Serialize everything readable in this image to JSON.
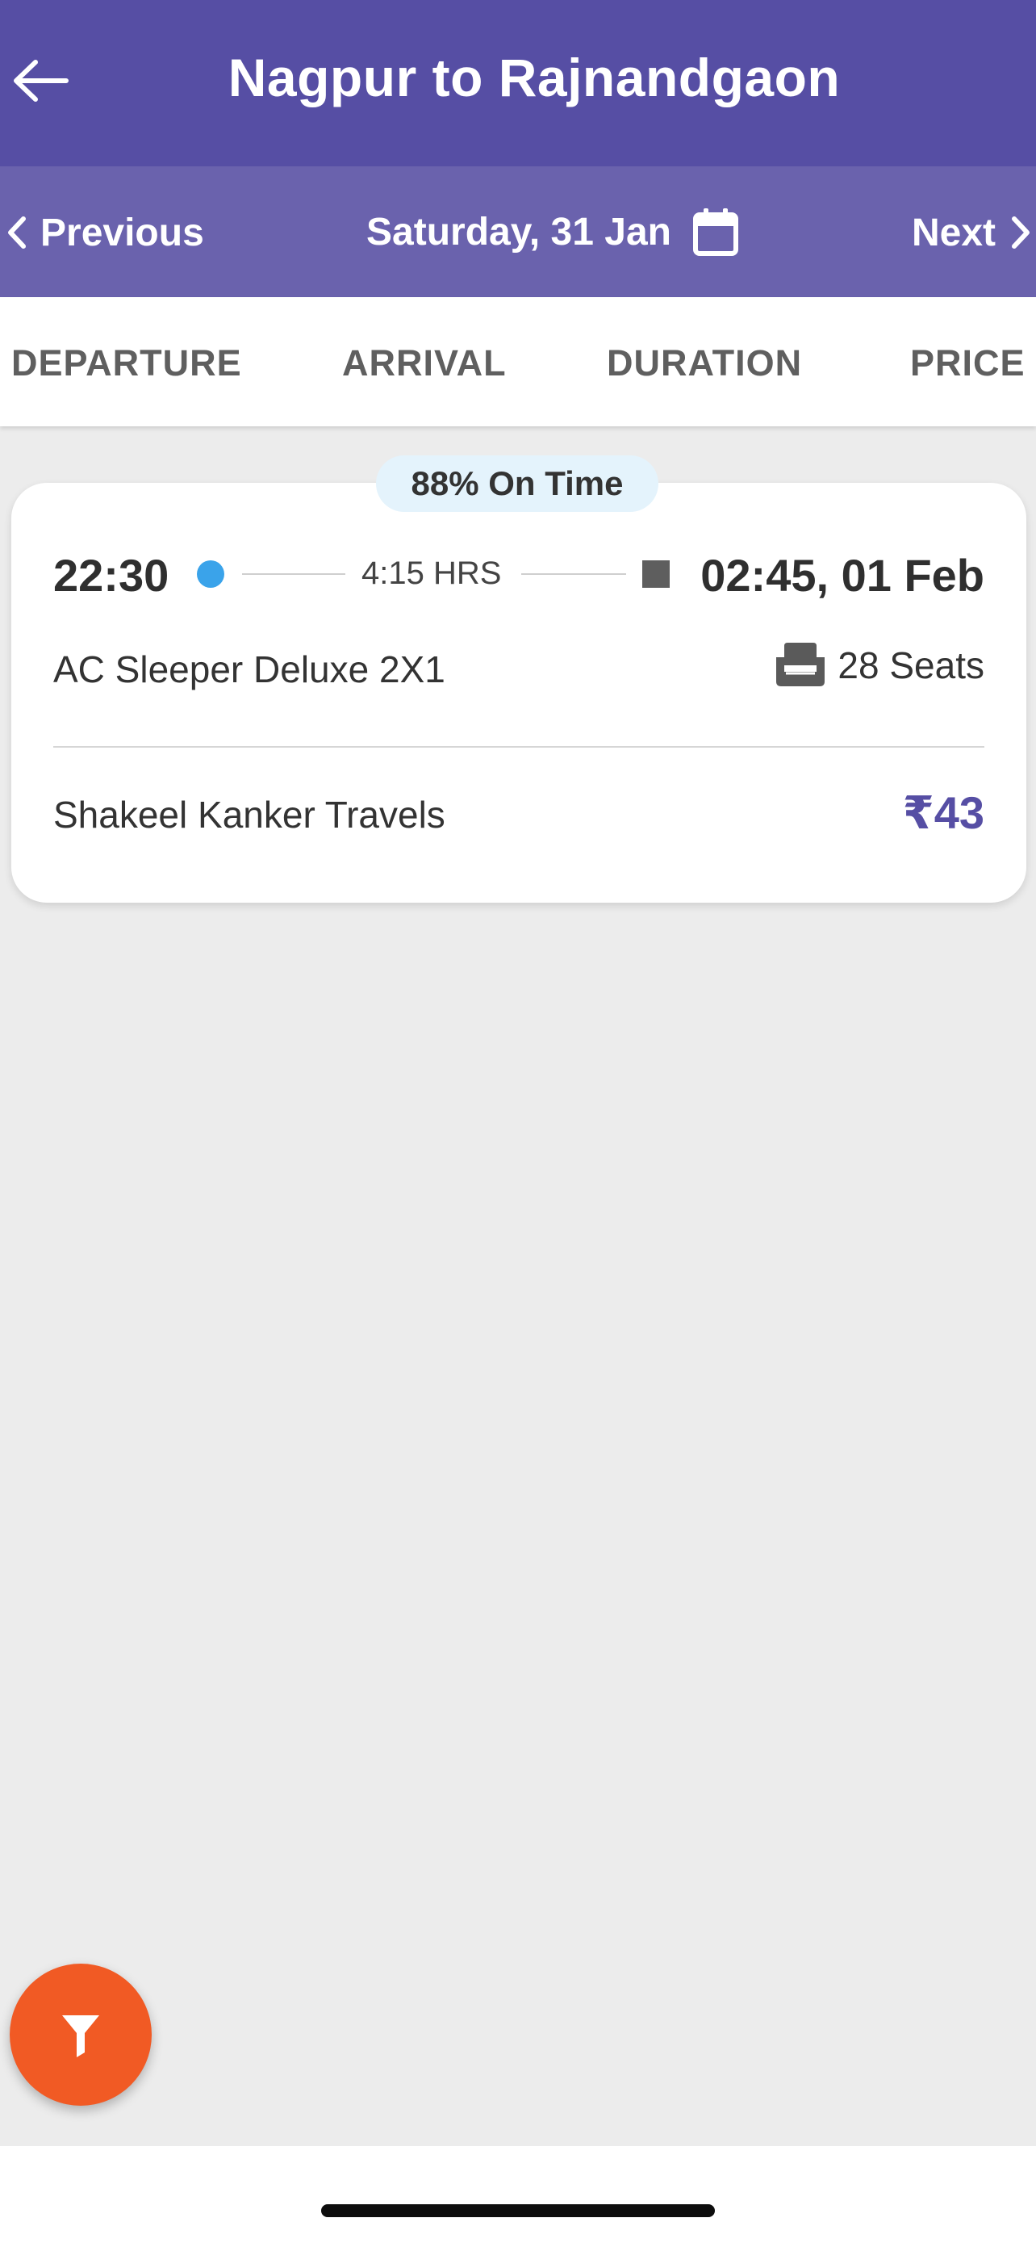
{
  "header": {
    "title": "Nagpur to Rajnandgaon",
    "back_icon": "arrow-left-icon"
  },
  "date_nav": {
    "previous_label": "Previous",
    "date_label": "Saturday, 31 Jan",
    "next_label": "Next",
    "calendar_icon": "calendar-icon"
  },
  "sort_tabs": [
    "DEPARTURE",
    "ARRIVAL",
    "DURATION",
    "PRICE"
  ],
  "results": [
    {
      "on_time_badge": "88% On Time",
      "departure_time": "22:30",
      "duration": "4:15 HRS",
      "arrival_time": "02:45, 01 Feb",
      "bus_type": "AC Sleeper Deluxe 2X1",
      "seats": "28 Seats",
      "operator": "Shakeel Kanker Travels",
      "price": "₹43"
    }
  ],
  "fab": {
    "icon": "filter-icon"
  },
  "colors": {
    "header": "#564ea4",
    "datebar": "#6a62ad",
    "accent_price": "#564ea4",
    "departure_dot": "#3aa3ea",
    "fab": "#f15a24",
    "on_time_bg": "#e4f3fc"
  }
}
